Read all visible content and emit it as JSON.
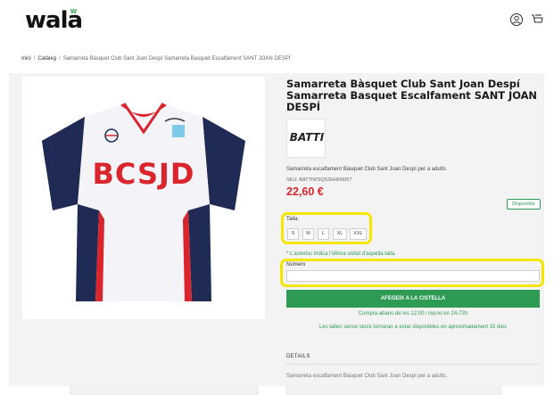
{
  "header": {
    "logo": "wala",
    "logo_sup": "w",
    "icons": {
      "user": "user-circle-icon",
      "cart": "cart-icon"
    }
  },
  "breadcrumb": {
    "home": "Inici",
    "separator": "/",
    "catalog": "Catàleg",
    "current": "Samarreta Bàsquet Club Sant Joan Despí Samarreta Basquet Escalfament SANT JOAN DESPÍ"
  },
  "product": {
    "title": "Samarreta Bàsquet Club Sant Joan Despí Samarreta Basquet Escalfament SANT JOAN DESPÍ",
    "brand": "BATTI",
    "description": "Samarreta escalfament Bàsquet Club Sant Joan Despí per a adults",
    "sku": "SKU: BATTIWSQSISHIR0057",
    "price": "22,60 €",
    "stock_badge": "Disponible",
    "image_text": "BCSJD",
    "size_label": "Talla:",
    "sizes": [
      "S",
      "M",
      "L",
      "XL",
      "XXL"
    ],
    "size_note": "* L'asterisc indica l'última unitat d'aquella talla.",
    "number_label": "Número",
    "number_value": "",
    "add_to_cart": "AFEGEIX A LA CISTELLA",
    "shipping": "Compra abans de les 12:00 i rep-lo en 24-72h",
    "availability": "Les talles sense stock tornaran a estar disponibles en aproximadament 15 dies",
    "details_title": "DETAILS",
    "details_text": "Samarreta escalfament Bàsquet Club Sant Joan Despí per a adults."
  },
  "colors": {
    "accent_green": "#2e9b55",
    "price_red": "#d9252b",
    "highlight_yellow": "#f5e600",
    "navy": "#1f2a55"
  }
}
